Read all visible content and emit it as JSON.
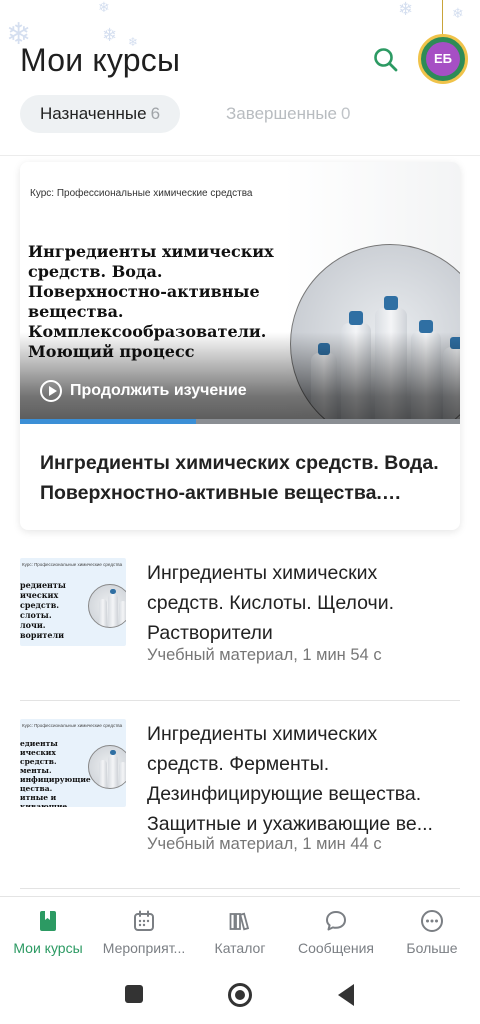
{
  "header": {
    "title": "Мои курсы",
    "avatar_initials": "ЕБ"
  },
  "tabs": [
    {
      "label": "Назначенные",
      "count": "6",
      "active": true
    },
    {
      "label": "Завершенные",
      "count": "0",
      "active": false
    }
  ],
  "featured": {
    "course_label": "Курс: Профессиональные химические средства",
    "image_heading": "Ингредиенты химических средств. Вода. Поверхностно-активные вещества. Комплексообразователи. Моющий процесс",
    "continue_label": "Продолжить изучение",
    "progress_fraction": 0.4,
    "title": "Ингредиенты химических средств. Вода. Поверхностно-активные вещества. Комплексообразователи. Моющий процесс"
  },
  "items": [
    {
      "title": "Ингредиенты химических средств. Кислоты. Щелочи. Растворители",
      "meta": "Учебный материал, 1 мин 54 с",
      "thumb_text": "редиенты\nических средств.\nслоты.\nлочи.\nворители"
    },
    {
      "title": "Ингредиенты химических средств. Ферменты. Дезинфицирующие вещества. Защитные и ухаживающие ве...",
      "meta": "Учебный материал, 1 мин 44 с",
      "thumb_text": "едиенты\nических средств.\nменты.\nинфицирующие\nцества.\nитные и\nкивающие вещества.\nматизаторы и\nители"
    }
  ],
  "nav": [
    {
      "label": "Мои курсы",
      "icon": "book-icon",
      "active": true
    },
    {
      "label": "Мероприят...",
      "icon": "calendar-icon",
      "active": false
    },
    {
      "label": "Каталог",
      "icon": "library-icon",
      "active": false
    },
    {
      "label": "Сообщения",
      "icon": "chat-icon",
      "active": false
    },
    {
      "label": "Больше",
      "icon": "more-icon",
      "active": false
    }
  ],
  "colors": {
    "accent": "#2c9a63",
    "progress": "#3b8fd6",
    "avatar_bg": "#a64fc4"
  }
}
